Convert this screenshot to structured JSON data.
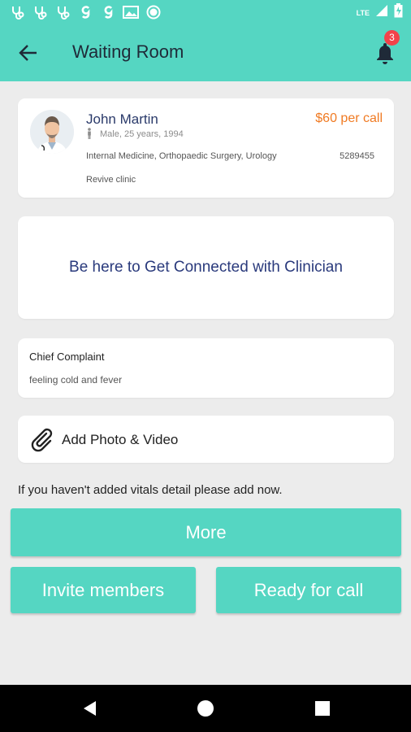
{
  "status_bar": {
    "icons": [
      "stethoscope-icon",
      "stethoscope-icon",
      "stethoscope-icon",
      "g-icon",
      "g-icon",
      "photo-icon",
      "circle-icon"
    ],
    "network": "LTE"
  },
  "app_bar": {
    "title": "Waiting Room",
    "notification_count": "3",
    "color": "#55d6c2"
  },
  "doctor": {
    "name": "John Martin",
    "price": "$60 per call",
    "meta": "Male, 25 years, 1994",
    "specialties": "Internal Medicine, Orthopaedic Surgery, Urology",
    "reg_no": "5289455",
    "clinic": "Revive clinic"
  },
  "connect": {
    "message": "Be here to Get  Connected with Clinician"
  },
  "complaint": {
    "label": "Chief Complaint",
    "value": "feeling cold and fever"
  },
  "media": {
    "label": "Add Photo & Video"
  },
  "vitals_note": "If you haven't added vitals detail please add now.",
  "buttons": {
    "more": "More",
    "invite": "Invite members",
    "ready": "Ready for call"
  },
  "colors": {
    "accent": "#55d6c2",
    "price": "#f07a22",
    "badge": "#f2424a"
  }
}
